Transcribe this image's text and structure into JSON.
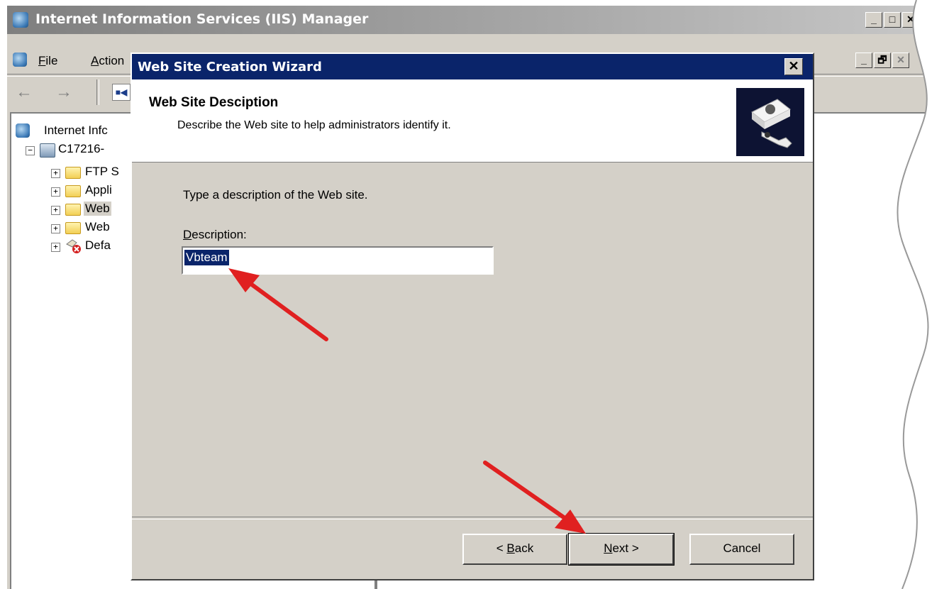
{
  "main_window": {
    "title": "Internet Information Services (IIS) Manager",
    "menu": {
      "file": "File",
      "file_mnemonic": "F",
      "file_rest": "ile",
      "action": "Action",
      "action_mnemonic": "A",
      "action_rest": "ction"
    },
    "min_label": "_",
    "max_label": "□",
    "restore_label": "🗗",
    "close_label": "✕"
  },
  "tree": {
    "items": [
      {
        "label": "Internet Infc",
        "icon": "iis-icon"
      },
      {
        "label": "C17216-",
        "icon": "server-icon",
        "expander": "−"
      },
      {
        "label": "FTP S",
        "icon": "folder-icon",
        "expander": "+"
      },
      {
        "label": "Appli",
        "icon": "folder-icon",
        "expander": "+"
      },
      {
        "label": "Web",
        "icon": "folder-icon",
        "expander": "+",
        "selected": true
      },
      {
        "label": "Web",
        "icon": "folder-icon",
        "expander": "+"
      },
      {
        "label": "Defa",
        "icon": "web-site-stopped-icon",
        "expander": "+"
      }
    ]
  },
  "dialog": {
    "title": "Web Site Creation Wizard",
    "close_label": "✕",
    "heading": "Web Site Desciption",
    "subheading": "Describe the Web site to help administrators identify it.",
    "instruction": "Type a description of the Web site.",
    "description_label_mnemonic": "D",
    "description_label_rest": "escription:",
    "description_value": "Vbteam",
    "buttons": {
      "back_prefix": "< ",
      "back_mnemonic": "B",
      "back_rest": "ack",
      "next_mnemonic": "N",
      "next_rest": "ext >",
      "cancel": "Cancel"
    }
  },
  "annotations": {
    "arrow_color": "#e02020"
  },
  "colors": {
    "dialog_title_bg": "#0a246a",
    "window_bg": "#d4d0c8"
  }
}
